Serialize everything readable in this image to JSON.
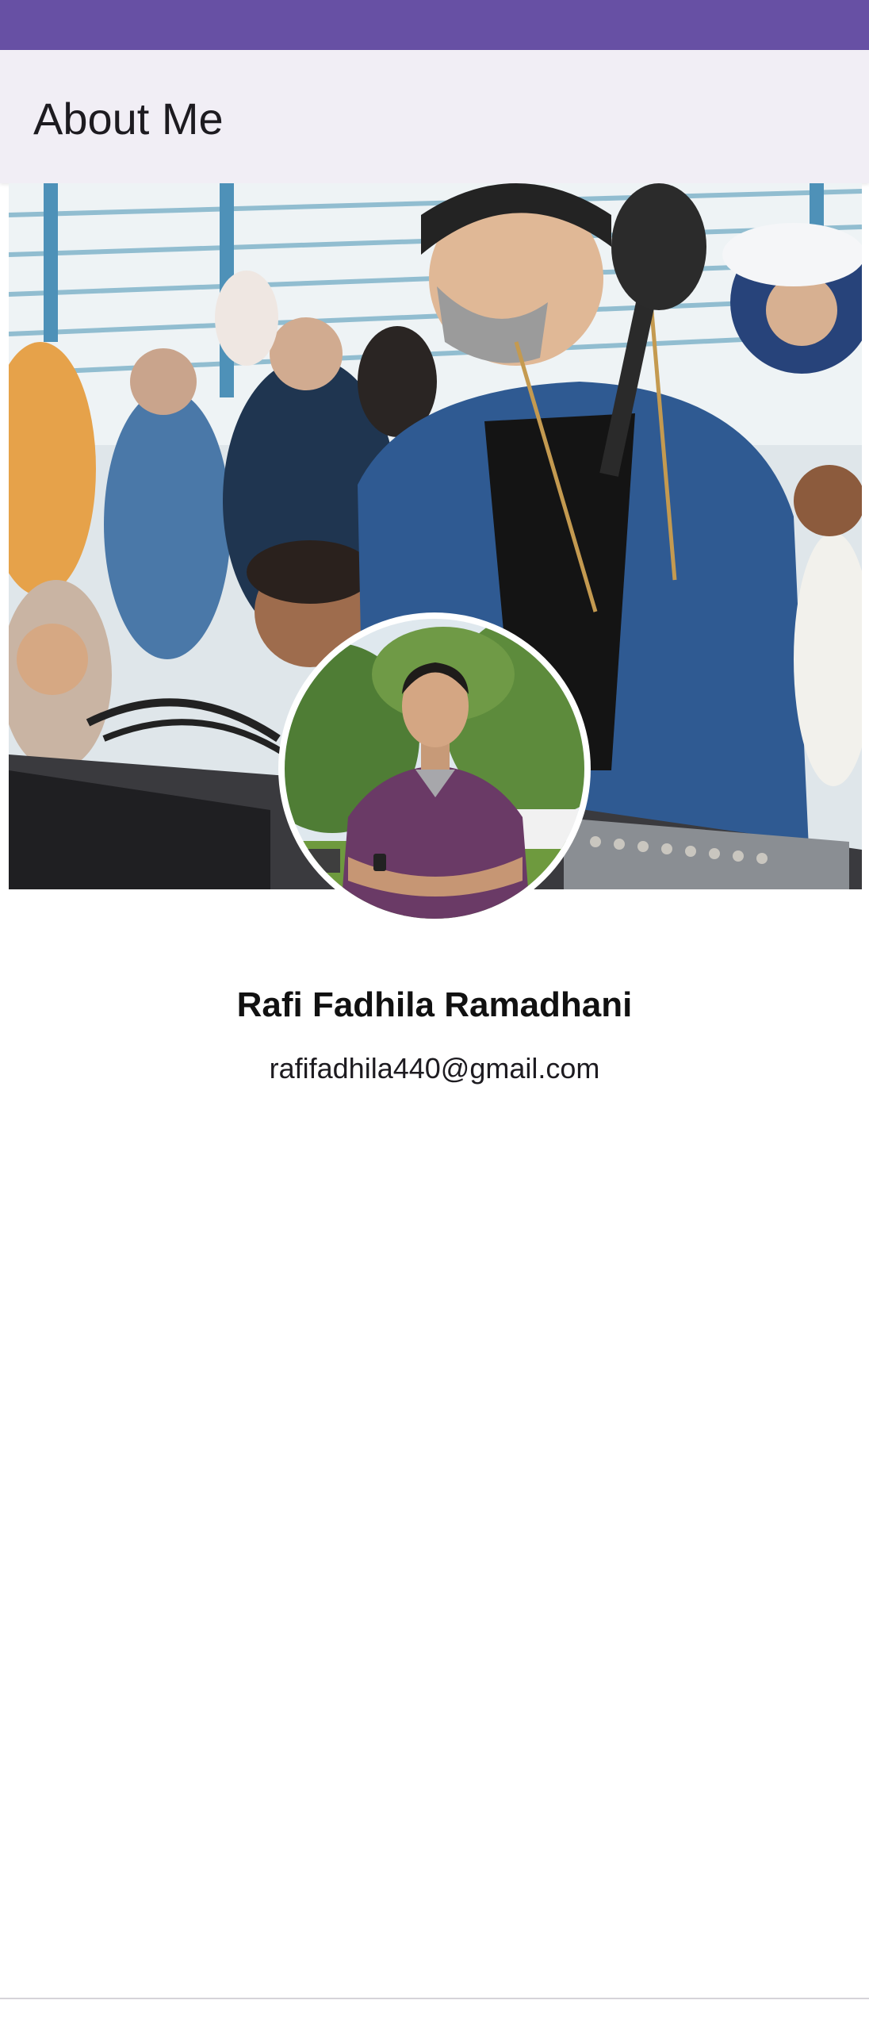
{
  "app_bar": {
    "title": "About Me"
  },
  "profile": {
    "name": "Rafi Fadhila Ramadhani",
    "email": "rafifadhila440@gmail.com",
    "cover_photo": "crowd-with-camera-photo",
    "avatar_photo": "portrait-photo"
  },
  "colors": {
    "status_bar": "#6750a4",
    "app_bar": "#f1eef5",
    "text": "#1d1b20"
  }
}
